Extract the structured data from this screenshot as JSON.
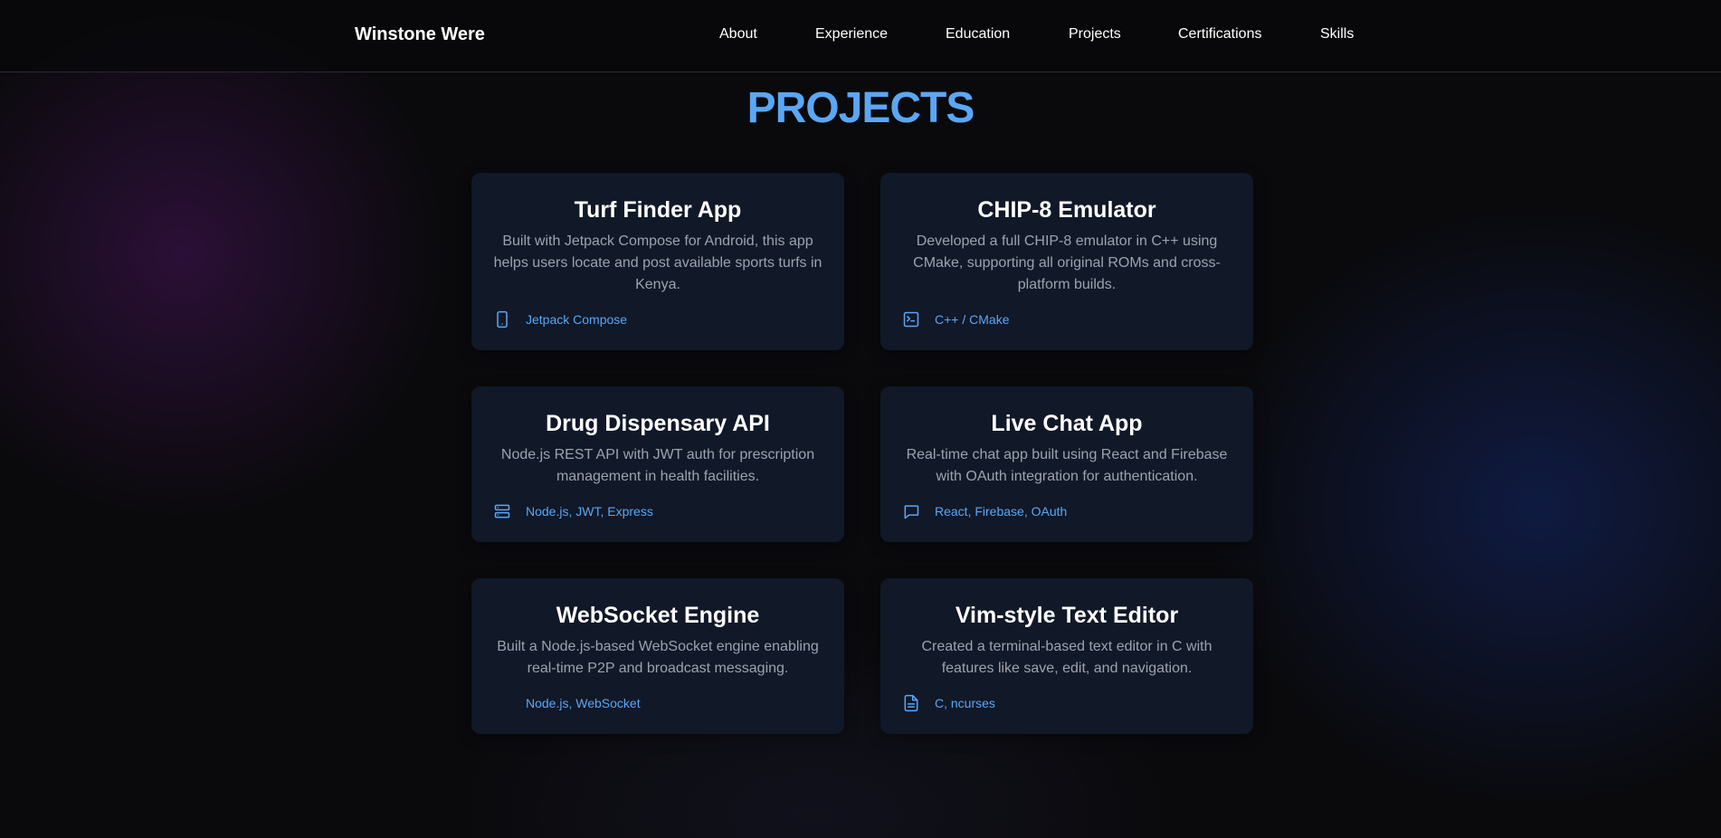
{
  "nav": {
    "brand": "Winstone Were",
    "links": [
      "About",
      "Experience",
      "Education",
      "Projects",
      "Certifications",
      "Skills"
    ]
  },
  "section": {
    "title": "PROJECTS"
  },
  "projects": [
    {
      "title": "Turf Finder App",
      "description": "Built with Jetpack Compose for Android, this app helps users locate and post available sports turfs in Kenya.",
      "tech": "Jetpack Compose",
      "icon": "smartphone-icon"
    },
    {
      "title": "CHIP-8 Emulator",
      "description": "Developed a full CHIP-8 emulator in C++ using CMake, supporting all original ROMs and cross-platform builds.",
      "tech": "C++ / CMake",
      "icon": "terminal-icon"
    },
    {
      "title": "Drug Dispensary API",
      "description": "Node.js REST API with JWT auth for prescription management in health facilities.",
      "tech": "Node.js, JWT, Express",
      "icon": "server-icon"
    },
    {
      "title": "Live Chat App",
      "description": "Real-time chat app built using React and Firebase with OAuth integration for authentication.",
      "tech": "React, Firebase, OAuth",
      "icon": "chat-bubble-icon"
    },
    {
      "title": "WebSocket Engine",
      "description": "Built a Node.js-based WebSocket engine enabling real-time P2P and broadcast messaging.",
      "tech": "Node.js, WebSocket",
      "icon": ""
    },
    {
      "title": "Vim-style Text Editor",
      "description": "Created a terminal-based text editor in C with features like save, edit, and navigation.",
      "tech": "C, ncurses",
      "icon": "document-icon"
    }
  ],
  "colors": {
    "accent": "#5aa7f5",
    "card_bg": "#111827",
    "muted_text": "#9ca3af"
  }
}
